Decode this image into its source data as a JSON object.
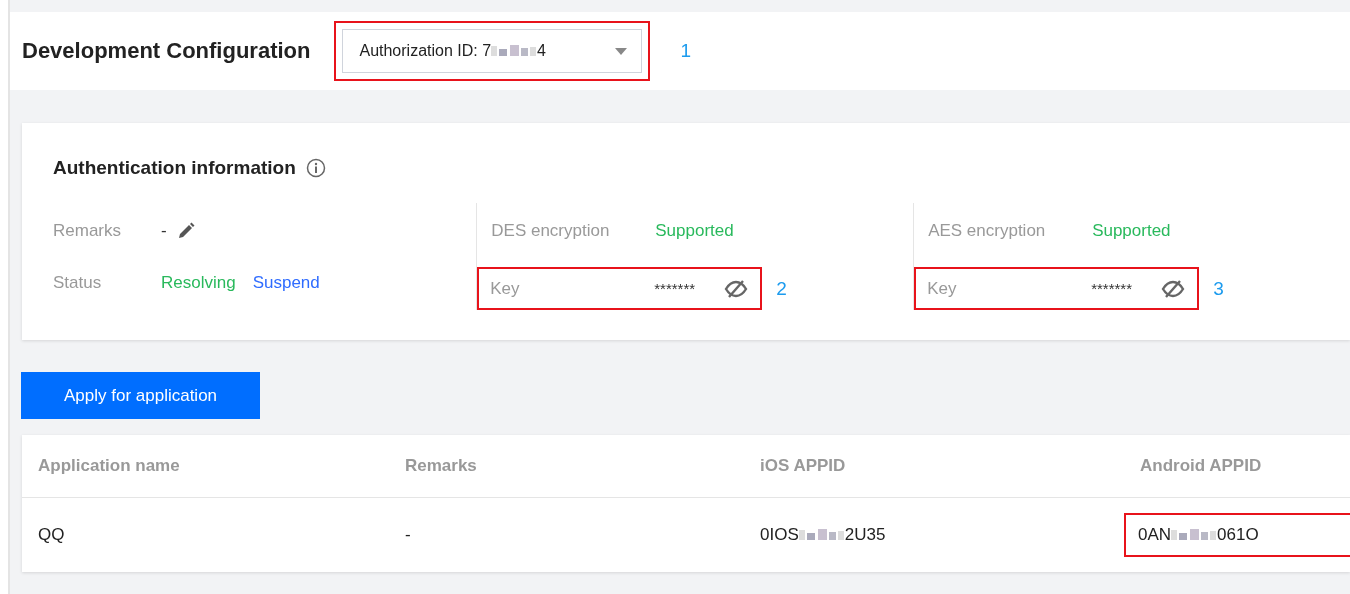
{
  "page_title": "Development Configuration",
  "authorization_dropdown": {
    "label": "Authorization ID: 7",
    "label_end": "4",
    "highlighted": true,
    "callout": "1"
  },
  "auth_card": {
    "title": "Authentication information",
    "remarks": {
      "label": "Remarks",
      "value": "-"
    },
    "status": {
      "label": "Status",
      "value": "Resolving",
      "action": "Suspend"
    },
    "encryptions": [
      {
        "label": "DES encryption",
        "value": "Supported",
        "key": {
          "label": "Key",
          "value": "*******",
          "hidden": true,
          "highlighted": true,
          "callout": "2"
        }
      },
      {
        "label": "AES encryption",
        "value": "Supported",
        "key": {
          "label": "Key",
          "value": "*******",
          "hidden": true,
          "highlighted": true,
          "callout": "3"
        }
      }
    ]
  },
  "apply_button": "Apply for application",
  "table": {
    "columns": [
      "Application name",
      "Remarks",
      "iOS APPID",
      "Android APPID"
    ],
    "rows": [
      {
        "cells": [
          {
            "text": "QQ"
          },
          {
            "text": "-"
          },
          {
            "text": "0IOS",
            "text_end": "2U35",
            "highlighted": false
          },
          {
            "text": "0AN",
            "text_end": "061O",
            "highlighted": true
          }
        ]
      }
    ]
  }
}
